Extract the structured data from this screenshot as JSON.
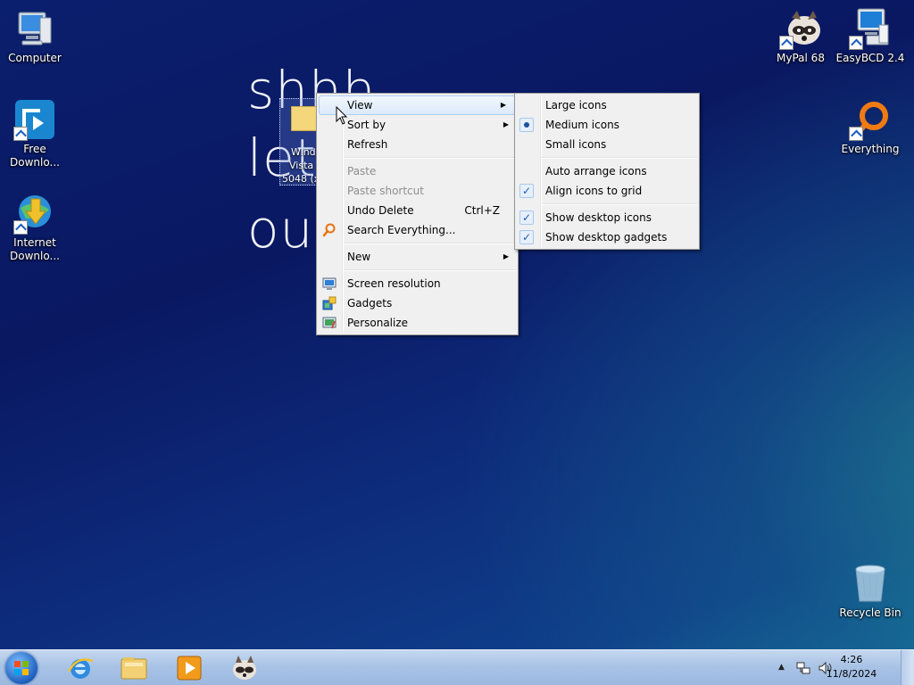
{
  "wallpaper_text": [
    "shhh",
    "let's",
    "our"
  ],
  "desktop": {
    "left_icons": [
      {
        "label": "Computer",
        "icon": "computer-icon"
      },
      {
        "label": "Free Downlo...",
        "icon": "free-download-manager-icon"
      },
      {
        "label": "Internet Downlo...",
        "icon": "internet-download-manager-icon"
      }
    ],
    "right_icons": [
      {
        "label": "MyPal 68",
        "icon": "mypal-raccoon-icon"
      },
      {
        "label": "EasyBCD 2.4",
        "icon": "easybcd-icon"
      },
      {
        "label": "Everything",
        "icon": "everything-search-icon"
      },
      {
        "label": "Recycle Bin",
        "icon": "recycle-bin-icon"
      }
    ],
    "selected_item": {
      "lines": [
        "Wind",
        "Vista",
        "5048 (x"
      ]
    }
  },
  "context_menu": {
    "items": [
      {
        "label": "View",
        "submenu": true,
        "highlighted": true
      },
      {
        "label": "Sort by",
        "submenu": true
      },
      {
        "label": "Refresh"
      },
      {
        "label": "Paste",
        "disabled": true
      },
      {
        "label": "Paste shortcut",
        "disabled": true
      },
      {
        "label": "Undo Delete",
        "shortcut": "Ctrl+Z"
      },
      {
        "label": "Search Everything...",
        "icon": "magnifier-icon"
      },
      {
        "label": "New",
        "submenu": true
      },
      {
        "label": "Screen resolution",
        "icon": "monitor-icon"
      },
      {
        "label": "Gadgets",
        "icon": "gadgets-icon"
      },
      {
        "label": "Personalize",
        "icon": "personalize-icon"
      }
    ]
  },
  "view_submenu": {
    "items": [
      {
        "label": "Large icons"
      },
      {
        "label": "Medium icons",
        "state": "radio-selected"
      },
      {
        "label": "Small icons"
      },
      {
        "label": "Auto arrange icons"
      },
      {
        "label": "Align icons to grid",
        "state": "checked"
      },
      {
        "label": "Show desktop icons",
        "state": "checked"
      },
      {
        "label": "Show desktop gadgets",
        "state": "checked"
      }
    ]
  },
  "taskbar": {
    "pinned": [
      "internet-explorer-icon",
      "windows-explorer-icon",
      "media-player-icon",
      "mypal-icon"
    ],
    "clock": {
      "time": "4:26",
      "date": "11/8/2024"
    }
  },
  "colors": {
    "menu_bg": "#f0f0f0",
    "highlight_border": "#aecff7",
    "taskbar": "#a9c3e6"
  }
}
